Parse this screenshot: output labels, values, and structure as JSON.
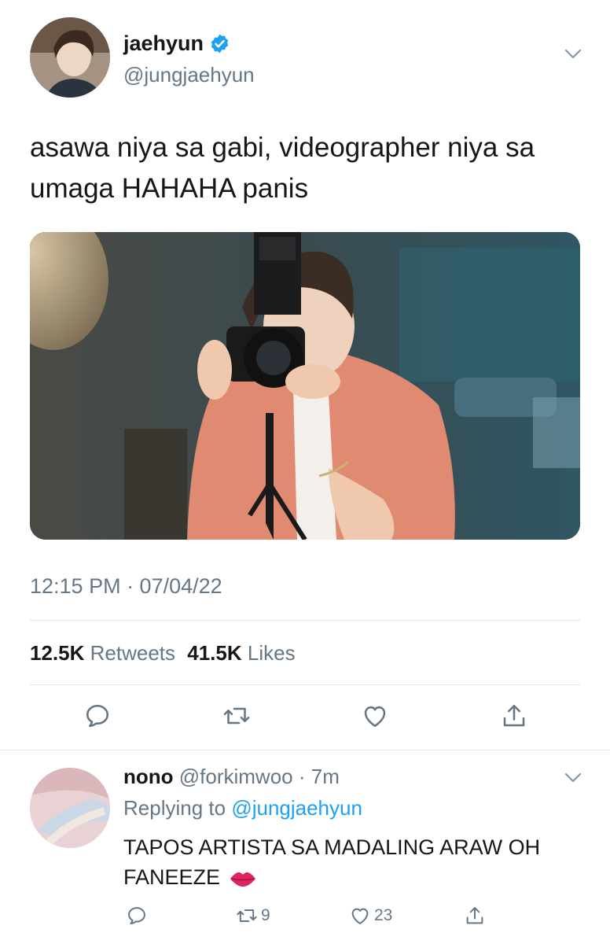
{
  "tweet": {
    "author_name": "jaehyun",
    "author_handle": "@jungjaehyun",
    "text": "asawa niya sa gabi, videographer niya sa umaga HAHAHA panis",
    "timestamp": "12:15 PM · 07/04/22",
    "retweets_count": "12.5K",
    "retweets_label": "Retweets",
    "likes_count": "41.5K",
    "likes_label": "Likes",
    "icons": [
      "reply-icon",
      "retweet-icon",
      "like-icon",
      "share-icon"
    ]
  },
  "reply": {
    "author_name": "nono",
    "author_handle": "@forkimwoo",
    "time": "· 7m",
    "replying_prefix": "Replying to",
    "replying_to": "@jungjaehyun",
    "text": "TAPOS ARTISTA SA MADALING ARAW OH FANEEZE",
    "emoji_icon": "lips-icon",
    "retweet_count": "9",
    "like_count": "23"
  },
  "colors": {
    "accent": "#1da1f2",
    "secondary_text": "#657786",
    "primary_text": "#14171a",
    "divider": "#e1e8ed"
  }
}
